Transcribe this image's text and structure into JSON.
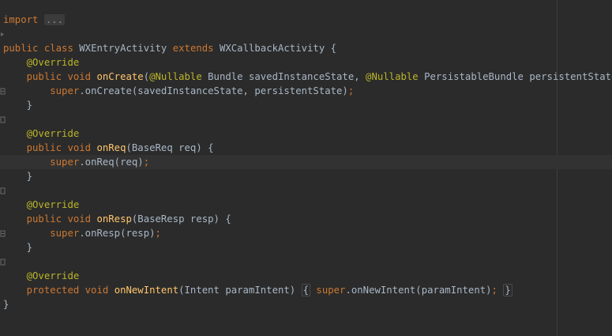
{
  "editor": {
    "import_keyword": "import",
    "import_folded": "...",
    "class_decl": {
      "public": "public",
      "class": "class",
      "name": "WXEntryActivity",
      "extends": "extends",
      "parent": "WXCallbackActivity",
      "open_brace": "{"
    },
    "methods": [
      {
        "annotation": "@Override",
        "modifiers": "public void",
        "name": "onCreate",
        "params_open": "(",
        "param1_annotation": "@Nullable",
        "param1": " Bundle savedInstanceState, ",
        "param2_annotation": "@Nullable",
        "param2": " PersistableBundle persistentState) {",
        "body_super": "super",
        "body_call": ".onCreate(savedInstanceState, persistentState)",
        "body_semi": ";",
        "close": "}"
      },
      {
        "annotation": "@Override",
        "modifiers": "public void",
        "name": "onReq",
        "params": "(BaseReq req) {",
        "body_super": "super",
        "body_call": ".onReq(req)",
        "body_semi": ";",
        "close": "}"
      },
      {
        "annotation": "@Override",
        "modifiers": "public void",
        "name": "onResp",
        "params": "(BaseResp resp) {",
        "body_super": "super",
        "body_call": ".onResp(resp)",
        "body_semi": ";",
        "close": "}"
      },
      {
        "annotation": "@Override",
        "modifiers": "protected void",
        "name": "onNewIntent",
        "params": "(Intent paramIntent)",
        "open_brace": "{",
        "body_super": "super",
        "body_call": ".onNewIntent(paramIntent)",
        "body_semi": ";",
        "close": "}"
      }
    ],
    "class_close": "}"
  }
}
